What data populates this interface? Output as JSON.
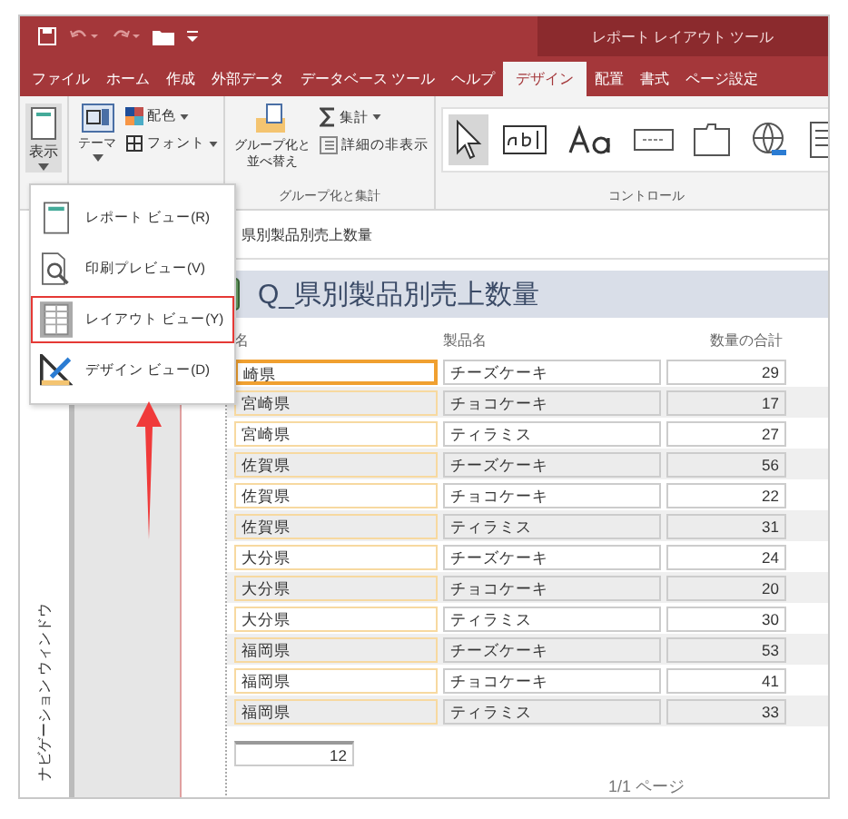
{
  "window": {
    "title": "レポート レイアウト ツール"
  },
  "tabs": [
    {
      "label": "ファイル",
      "selected": false
    },
    {
      "label": "ホーム",
      "selected": false
    },
    {
      "label": "作成",
      "selected": false
    },
    {
      "label": "外部データ",
      "selected": false
    },
    {
      "label": "データベース ツール",
      "selected": false
    },
    {
      "label": "ヘルプ",
      "selected": false
    },
    {
      "label": "デザイン",
      "selected": true
    },
    {
      "label": "配置",
      "selected": false
    },
    {
      "label": "書式",
      "selected": false
    },
    {
      "label": "ページ設定",
      "selected": false
    }
  ],
  "ribbon": {
    "view_button": "表示",
    "theme_button": "テーマ",
    "colors_button": "配色",
    "fonts_button": "フォント",
    "group_sort_button": [
      "グループ化と",
      "並べ替え"
    ],
    "totals_button": "集計",
    "hide_details_button": "詳細の非表示",
    "group_labels": [
      "グループ化と集計",
      "コントロール"
    ],
    "controls": [
      {
        "kind": "pointer",
        "selected": true
      },
      {
        "kind": "textbox",
        "selected": false
      },
      {
        "kind": "label",
        "selected": false
      },
      {
        "kind": "button",
        "selected": false
      },
      {
        "kind": "tab",
        "selected": false
      },
      {
        "kind": "hyperlink",
        "selected": false
      },
      {
        "kind": "form",
        "selected": false
      }
    ]
  },
  "view_menu": {
    "items": [
      {
        "kind": "report",
        "label": "レポート ビュー(R)",
        "selected": false
      },
      {
        "kind": "preview",
        "label": "印刷プレビュー(V)",
        "selected": false
      },
      {
        "kind": "layout",
        "label": "レイアウト ビュー(Y)",
        "selected": true
      },
      {
        "kind": "design",
        "label": "デザイン ビュー(D)",
        "selected": false
      }
    ]
  },
  "nav_pane": {
    "title": "ナビゲーション ウィンドウ"
  },
  "document": {
    "tab": "県別製品別売上数量",
    "title": "Q_県別製品別売上数量",
    "columns": [
      "名",
      "製品名",
      "数量の合計"
    ],
    "rows": [
      {
        "cells": [
          "崎県",
          "チーズケーキ",
          "29"
        ],
        "selected": true
      },
      {
        "cells": [
          "宮崎県",
          "チョコケーキ",
          "17"
        ],
        "selected": false
      },
      {
        "cells": [
          "宮崎県",
          "ティラミス",
          "27"
        ],
        "selected": false
      },
      {
        "cells": [
          "佐賀県",
          "チーズケーキ",
          "56"
        ],
        "selected": false
      },
      {
        "cells": [
          "佐賀県",
          "チョコケーキ",
          "22"
        ],
        "selected": false
      },
      {
        "cells": [
          "佐賀県",
          "ティラミス",
          "31"
        ],
        "selected": false
      },
      {
        "cells": [
          "大分県",
          "チーズケーキ",
          "24"
        ],
        "selected": false
      },
      {
        "cells": [
          "大分県",
          "チョコケーキ",
          "20"
        ],
        "selected": false
      },
      {
        "cells": [
          "大分県",
          "ティラミス",
          "30"
        ],
        "selected": false
      },
      {
        "cells": [
          "福岡県",
          "チーズケーキ",
          "53"
        ],
        "selected": false
      },
      {
        "cells": [
          "福岡県",
          "チョコケーキ",
          "41"
        ],
        "selected": false
      },
      {
        "cells": [
          "福岡県",
          "ティラミス",
          "33"
        ],
        "selected": false
      }
    ],
    "total": "12",
    "page": "1/1 ページ"
  }
}
